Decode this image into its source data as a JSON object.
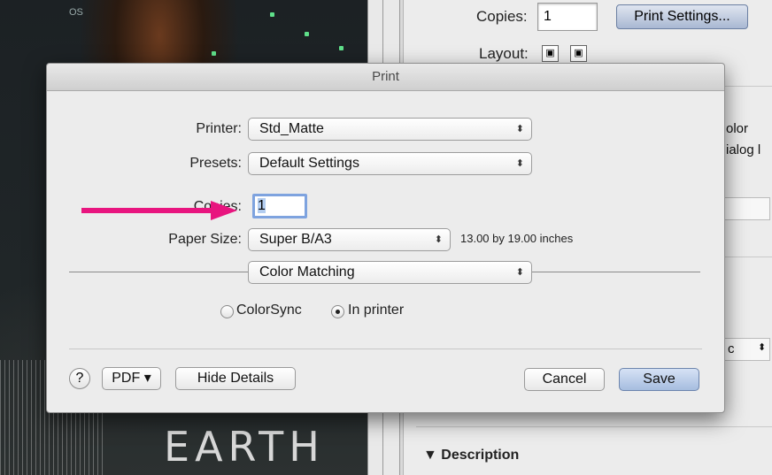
{
  "background": {
    "photo_text_top": "OS",
    "photo_text_bottom": "EARTH"
  },
  "right_panel": {
    "copies_label": "Copies:",
    "copies_value": "1",
    "print_settings_button": "Print Settings...",
    "layout_label": "Layout:",
    "fragment_color": "olor",
    "fragment_dialog": "ialog l",
    "fragment_c": "c",
    "description_label": "▼ Description"
  },
  "dialog": {
    "title": "Print",
    "printer_label": "Printer:",
    "printer_value": "Std_Matte",
    "presets_label": "Presets:",
    "presets_value": "Default Settings",
    "copies_label": "Copies:",
    "copies_value": "1",
    "paper_size_label": "Paper Size:",
    "paper_size_value": "Super B/A3",
    "paper_size_info": "13.00 by 19.00 inches",
    "section_value": "Color Matching",
    "radio_colorsync": "ColorSync",
    "radio_in_printer": "In printer",
    "selected_radio": "In printer",
    "help_label": "?",
    "pdf_button": "PDF ▾",
    "hide_details_button": "Hide Details",
    "cancel_button": "Cancel",
    "save_button": "Save"
  },
  "icons": {
    "popup_arrow": "up-down-chevron-icon",
    "annotation_arrow": "pink-arrow-icon"
  },
  "colors": {
    "accent": "#7ea3df",
    "annotation_arrow": "#e8157f",
    "default_button": "#a6bddf"
  }
}
